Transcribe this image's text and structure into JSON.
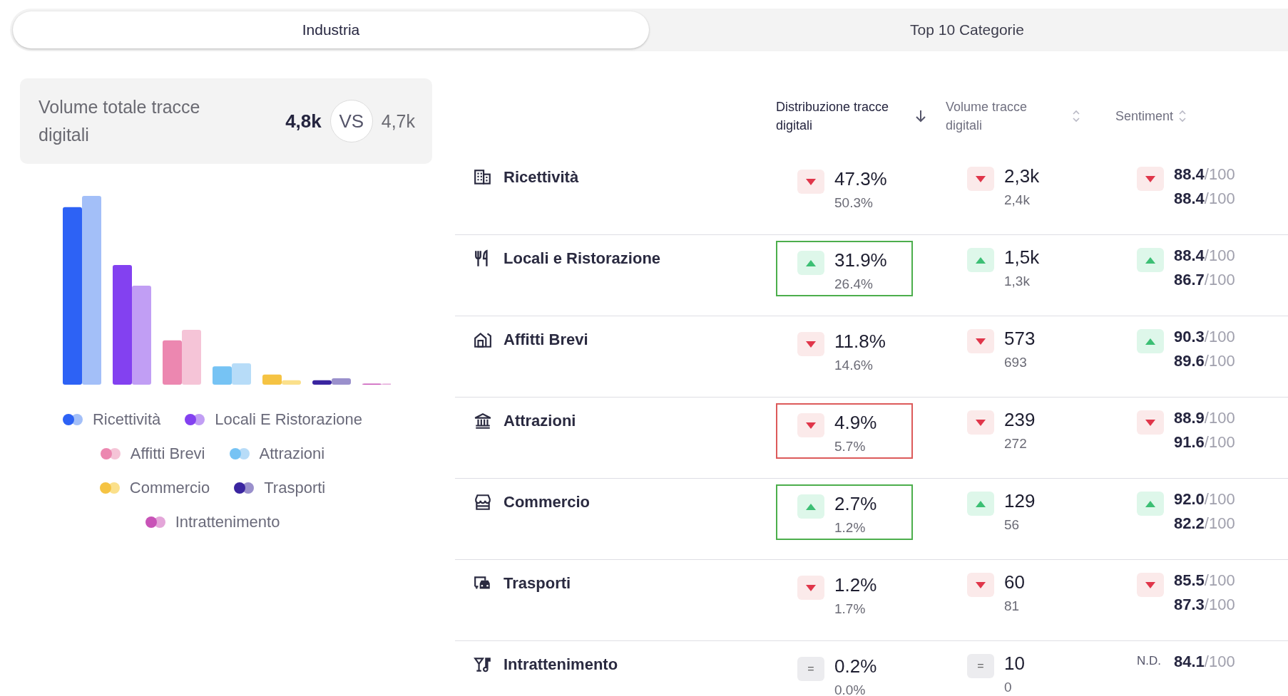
{
  "tabs": [
    {
      "label": "Industria",
      "selected": true
    },
    {
      "label": "Top 10 Categorie",
      "selected": false
    }
  ],
  "summary": {
    "label": "Volume totale tracce digitali",
    "current": "4,8k",
    "versus": "VS",
    "previous": "4,7k"
  },
  "legend": [
    {
      "label": "Ricettività",
      "color": "#2d62f5",
      "previous": {
        "color": "#a3bff8"
      }
    },
    {
      "label": "Locali E Ristorazione",
      "color": "#8341f0",
      "previous": {
        "color": "#c19ef4"
      }
    },
    {
      "label": "Affitti Brevi",
      "color": "#ec87b0",
      "previous": {
        "color": "#f5c4d7"
      }
    },
    {
      "label": "Attrazioni",
      "color": "#76c3f4",
      "previous": {
        "color": "#b7dcf8"
      }
    },
    {
      "label": "Commercio",
      "color": "#f5c343",
      "previous": {
        "color": "#fbe08b"
      }
    },
    {
      "label": "Trasporti",
      "color": "#3a25a0",
      "previous": {
        "color": "#9a90cc"
      }
    },
    {
      "label": "Intrattenimento",
      "color": "#c853b7",
      "previous": {
        "color": "#e4a6d9"
      }
    }
  ],
  "table": {
    "columns": [
      {
        "label": "Distribuzione tracce digitali",
        "sorted": true
      },
      {
        "label": "Volume tracce digitali",
        "sorted": false
      },
      {
        "label": "Sentiment",
        "sorted": false
      }
    ],
    "rows": [
      {
        "kind": "building",
        "name": "Ricettività",
        "distribution": {
          "kind": "down",
          "current": "47.3%",
          "previous": "50.3%"
        },
        "volume": {
          "kind": "down",
          "current": "2,3k",
          "previous": "2,4k"
        },
        "sentiment": {
          "kind": "down",
          "current": "88.4",
          "current_scale": "/100",
          "previous": "88.4",
          "previous_scale": "/100"
        }
      },
      {
        "kind": "cutlery",
        "name": "Locali e Ristorazione",
        "distribution": {
          "kind": "up",
          "color": "#4cae4c",
          "current": "31.9%",
          "previous": "26.4%"
        },
        "volume": {
          "kind": "up",
          "current": "1,5k",
          "previous": "1,3k"
        },
        "sentiment": {
          "kind": "up",
          "current": "88.4",
          "current_scale": "/100",
          "previous": "86.7",
          "previous_scale": "/100"
        }
      },
      {
        "kind": "house",
        "name": "Affitti Brevi",
        "distribution": {
          "kind": "down",
          "current": "11.8%",
          "previous": "14.6%"
        },
        "volume": {
          "kind": "down",
          "current": "573",
          "previous": "693"
        },
        "sentiment": {
          "kind": "up",
          "current": "90.3",
          "current_scale": "/100",
          "previous": "89.6",
          "previous_scale": "/100"
        }
      },
      {
        "kind": "museum",
        "name": "Attrazioni",
        "distribution": {
          "kind": "down",
          "color": "#dc5a5a",
          "current": "4.9%",
          "previous": "5.7%"
        },
        "volume": {
          "kind": "down",
          "current": "239",
          "previous": "272"
        },
        "sentiment": {
          "kind": "down",
          "current": "88.9",
          "current_scale": "/100",
          "previous": "91.6",
          "previous_scale": "/100"
        }
      },
      {
        "kind": "store",
        "name": "Commercio",
        "distribution": {
          "kind": "up",
          "color": "#4cae4c",
          "current": "2.7%",
          "previous": "1.2%"
        },
        "volume": {
          "kind": "up",
          "current": "129",
          "previous": "56"
        },
        "sentiment": {
          "kind": "up",
          "current": "92.0",
          "current_scale": "/100",
          "previous": "82.2",
          "previous_scale": "/100"
        }
      },
      {
        "kind": "bus",
        "name": "Trasporti",
        "distribution": {
          "kind": "down",
          "current": "1.2%",
          "previous": "1.7%"
        },
        "volume": {
          "kind": "down",
          "current": "60",
          "previous": "81"
        },
        "sentiment": {
          "kind": "down",
          "current": "85.5",
          "current_scale": "/100",
          "previous": "87.3",
          "previous_scale": "/100"
        }
      },
      {
        "kind": "drink",
        "name": "Intrattenimento",
        "distribution": {
          "kind": "equal",
          "symbol": "=",
          "current": "0.2%",
          "previous": "0.0%"
        },
        "volume": {
          "kind": "equal",
          "symbol": "=",
          "current": "10",
          "previous": "0"
        },
        "sentiment": {
          "kind": "note",
          "note": "N.D.",
          "current": "84.1",
          "current_scale": "/100"
        }
      }
    ]
  }
}
